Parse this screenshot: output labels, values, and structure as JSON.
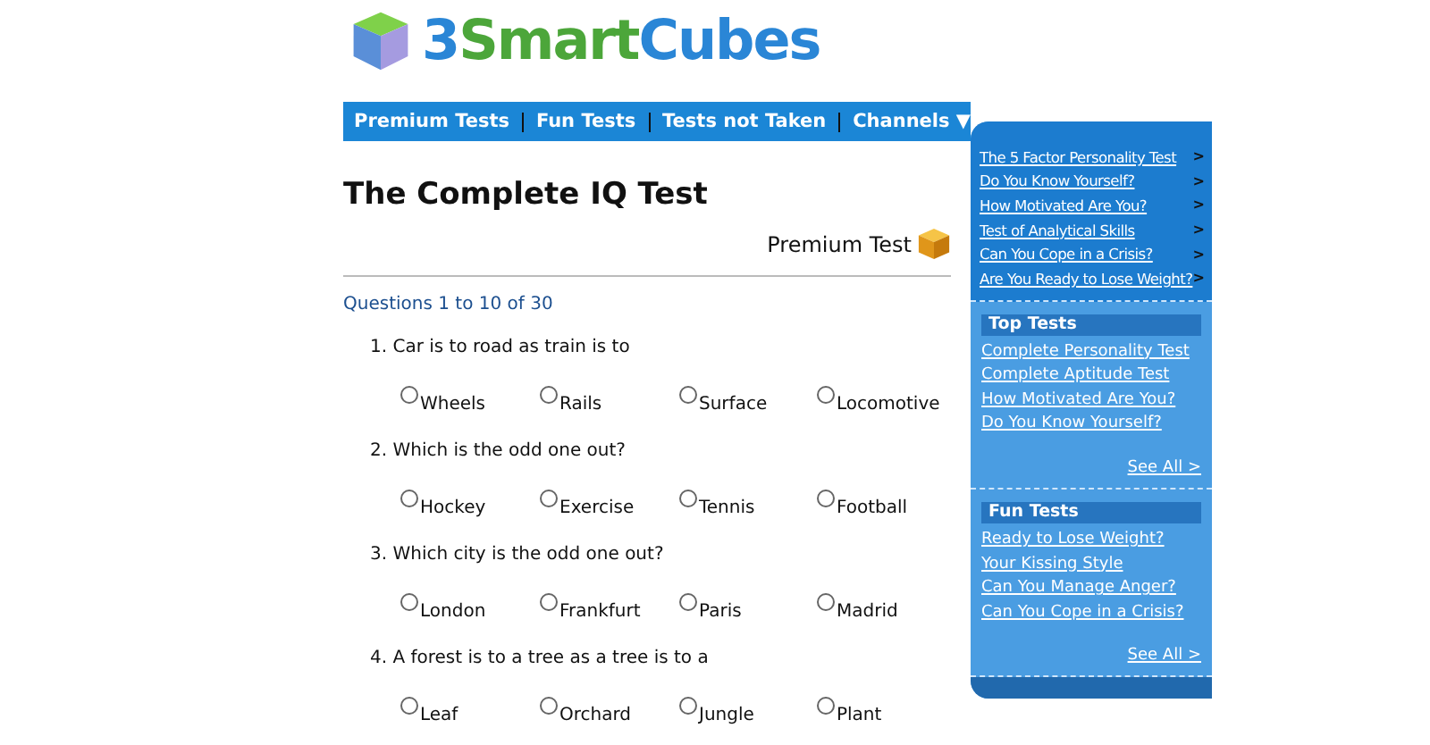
{
  "logo": {
    "parts": [
      {
        "text": "3",
        "color": "#2a86d6"
      },
      {
        "text": "Smart",
        "color": "#4ca63a"
      },
      {
        "text": "Cubes",
        "color": "#2a86d6"
      }
    ]
  },
  "nav": [
    "Premium Tests",
    "Fun Tests",
    "Tests not Taken",
    "Channels ▼"
  ],
  "title": "The Complete IQ Test",
  "badge": "Premium Test",
  "range": "Questions 1 to 10 of 30",
  "questions": [
    {
      "text": "1. Car is to road as train is to",
      "options": [
        {
          "label": "Wheels",
          "selected": false
        },
        {
          "label": "Rails",
          "selected": false
        },
        {
          "label": "Surface",
          "selected": false
        },
        {
          "label": "Locomotive",
          "selected": false
        }
      ]
    },
    {
      "text": "2. Which is the odd one out?",
      "options": [
        {
          "label": "Hockey",
          "selected": false
        },
        {
          "label": "Exercise",
          "selected": false
        },
        {
          "label": "Tennis",
          "selected": false
        },
        {
          "label": "Football",
          "selected": false
        }
      ]
    },
    {
      "text": "3. Which city is the odd one out?",
      "options": [
        {
          "label": "London",
          "selected": false
        },
        {
          "label": "Frankfurt",
          "selected": false
        },
        {
          "label": "Paris",
          "selected": false
        },
        {
          "label": "Madrid",
          "selected": false
        }
      ]
    },
    {
      "text": "4. A forest is to a tree as a tree is to a",
      "options": [
        {
          "label": "Leaf",
          "selected": false
        },
        {
          "label": "Orchard",
          "selected": false
        },
        {
          "label": "Jungle",
          "selected": false
        },
        {
          "label": "Plant",
          "selected": false
        }
      ]
    }
  ],
  "sidebar": {
    "featured": [
      {
        "label": "The 5 Factor Personality Test",
        "arrow": ">"
      },
      {
        "label": "Do You Know Yourself?",
        "arrow": ">"
      },
      {
        "label": "How Motivated Are You?",
        "arrow": ">"
      },
      {
        "label": "Test of Analytical Skills",
        "arrow": ">"
      },
      {
        "label": "Can You Cope in a Crisis?",
        "arrow": ">"
      },
      {
        "label": "Are You Ready to Lose Weight?",
        "arrow": ">"
      }
    ],
    "sections": [
      {
        "heading": "Top Tests",
        "links": [
          "Complete Personality Test",
          "Complete Aptitude Test",
          "How Motivated Are You?",
          "Do You Know Yourself?"
        ],
        "see_all": "See All >"
      },
      {
        "heading": "Fun Tests",
        "links": [
          "Ready to Lose Weight?",
          "Your Kissing Style",
          "Can You Manage Anger?",
          "Can You Cope in a Crisis?"
        ],
        "see_all": "See All >"
      }
    ]
  }
}
